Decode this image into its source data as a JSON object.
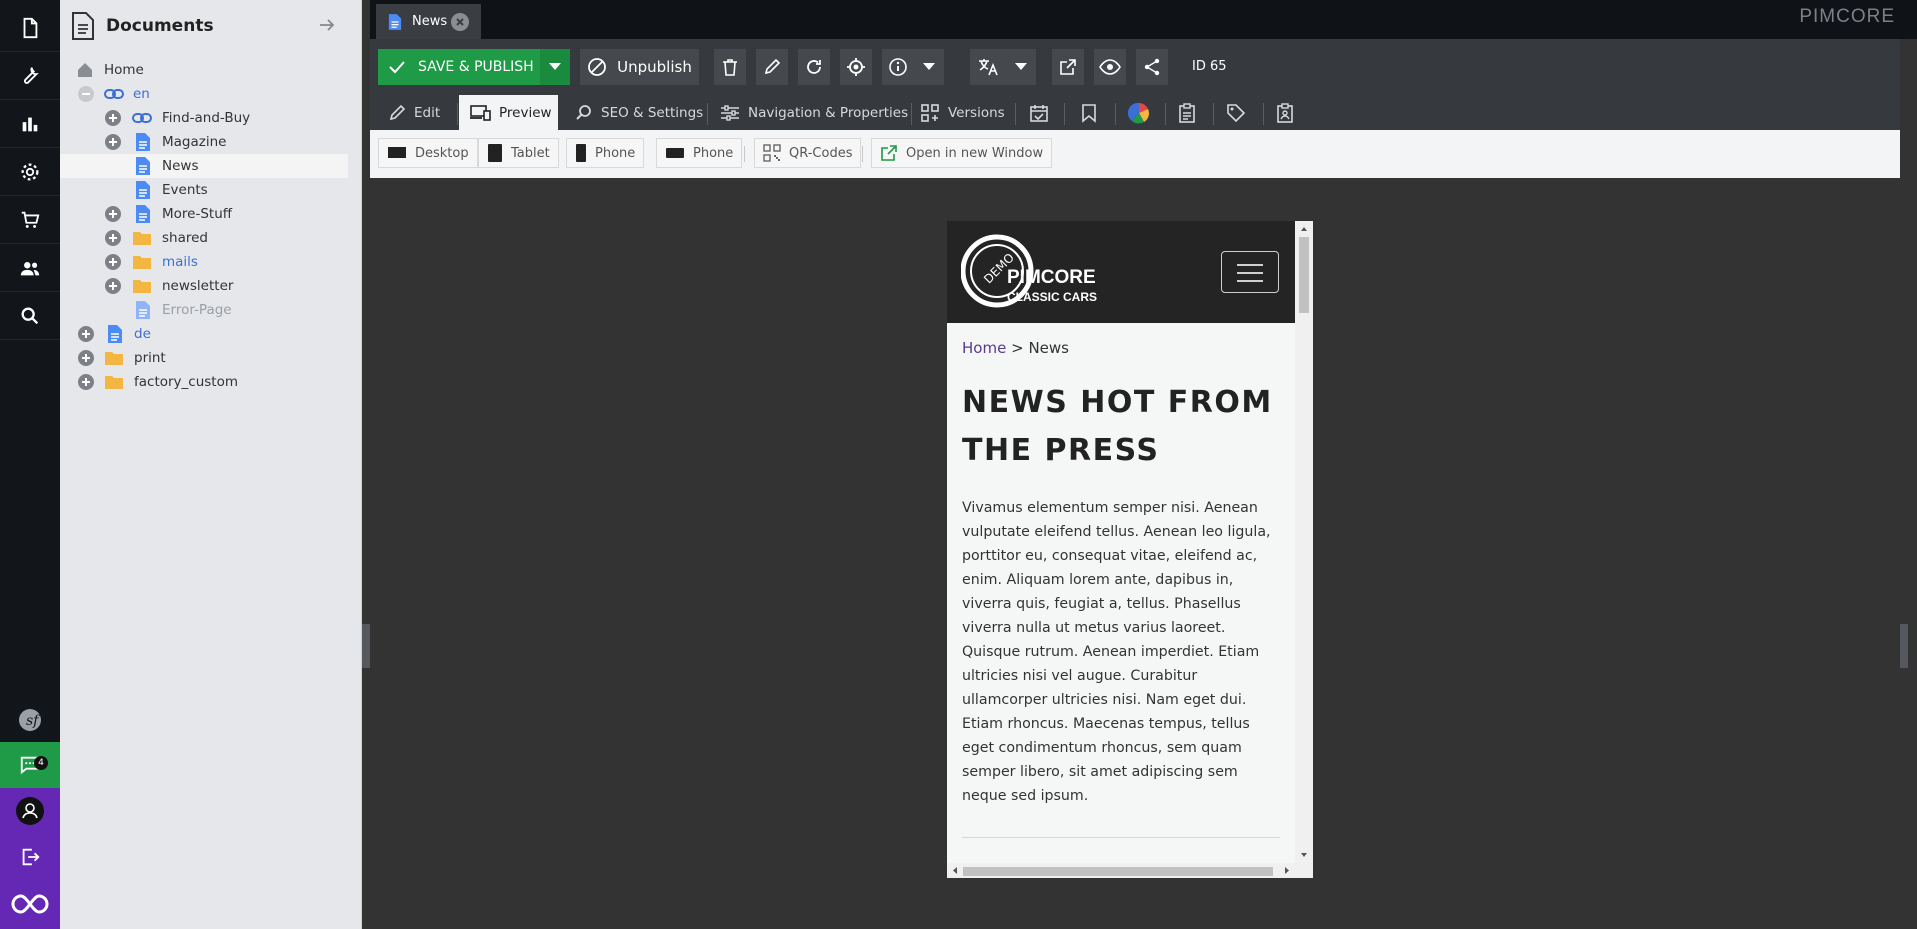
{
  "brand": "PIMCORE",
  "tree": {
    "title": "Documents",
    "items": [
      {
        "label": "Home"
      },
      {
        "label": "en"
      },
      {
        "label": "Find-and-Buy"
      },
      {
        "label": "Magazine"
      },
      {
        "label": "News"
      },
      {
        "label": "Events"
      },
      {
        "label": "More-Stuff"
      },
      {
        "label": "shared"
      },
      {
        "label": "mails"
      },
      {
        "label": "newsletter"
      },
      {
        "label": "Error-Page"
      },
      {
        "label": "de"
      },
      {
        "label": "print"
      },
      {
        "label": "factory_custom"
      }
    ]
  },
  "tabbar": {
    "doc_tab": "News"
  },
  "toolbar": {
    "save_publish": "SAVE & PUBLISH",
    "unpublish": "Unpublish",
    "id_label": "ID 65"
  },
  "subtabs": {
    "edit": "Edit",
    "preview": "Preview",
    "seo": "SEO & Settings",
    "navigation": "Navigation & Properties",
    "versions": "Versions"
  },
  "devices": {
    "desktop": "Desktop",
    "tablet": "Tablet",
    "phone1": "Phone",
    "phone2": "Phone",
    "qr": "QR-Codes",
    "open_new": "Open in new Window"
  },
  "site": {
    "logo_demo": "DEMO",
    "logo_name": "PIMCORE",
    "logo_sub": "CLASSIC CARS",
    "breadcrumb_home": "Home",
    "breadcrumb_sep": ">",
    "breadcrumb_current": "News",
    "headline": "NEWS HOT FROM THE PRESS",
    "body": "Vivamus elementum semper nisi. Aenean vulputate eleifend tellus. Aenean leo ligula, porttitor eu, consequat vitae, eleifend ac, enim. Aliquam lorem ante, dapibus in, viverra quis, feugiat a, tellus. Phasellus viverra nulla ut metus varius laoreet. Quisque rutrum. Aenean imperdiet. Etiam ultricies nisi vel augue. Curabitur ullamcorper ultricies nisi. Nam eget dui. Etiam rhoncus. Maecenas tempus, tellus eget condimentum rhoncus, sem quam semper libero, sit amet adipiscing sem neque sed ipsum."
  },
  "notifications": {
    "count": "4"
  },
  "colors": {
    "rail": "#121519",
    "save_green": "#1f9a47",
    "toolbar": "#36393e",
    "purple": "#6428b4",
    "link_blue": "#3b6fd6"
  }
}
